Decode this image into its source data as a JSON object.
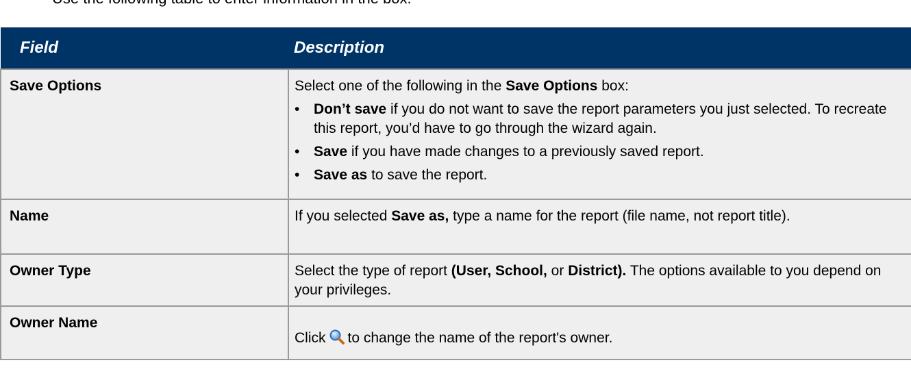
{
  "intro": {
    "text": "Use the following table to enter information in the box."
  },
  "table": {
    "headers": {
      "field": "Field",
      "description": "Description"
    },
    "rows": [
      {
        "field": "Save Options",
        "intro_prefix": "Select one of the following in the ",
        "intro_bold": "Save Options",
        "intro_suffix": " box:",
        "bullets": [
          {
            "bullet": "•",
            "bold": "Don’t save",
            "text": " if you do not want to save the report parameters you just selected. To recreate this report, you’d have to go through the wizard again."
          },
          {
            "bullet": "•",
            "bold": "Save",
            "text": " if you have made changes to a previously saved report."
          },
          {
            "bullet": "•",
            "bold": "Save as",
            "text": " to save the report."
          }
        ]
      },
      {
        "field": "Name",
        "prefix": "If you selected ",
        "bold": "Save as,",
        "suffix": " type a name for the report (file name, not report title)."
      },
      {
        "field": "Owner Type",
        "prefix": "Select the type of report ",
        "bold1": "(User, School,",
        "middle": " or ",
        "bold2": "District).",
        "suffix": " The options available to you depend on your privileges."
      },
      {
        "field": "Owner Name",
        "prefix": "Click",
        "icon": "magnifier-icon",
        "suffix": "to change the name of the report's owner."
      }
    ]
  },
  "colors": {
    "header_bg": "#003366",
    "cell_bg": "#efefef",
    "border": "#9a9a9a"
  }
}
